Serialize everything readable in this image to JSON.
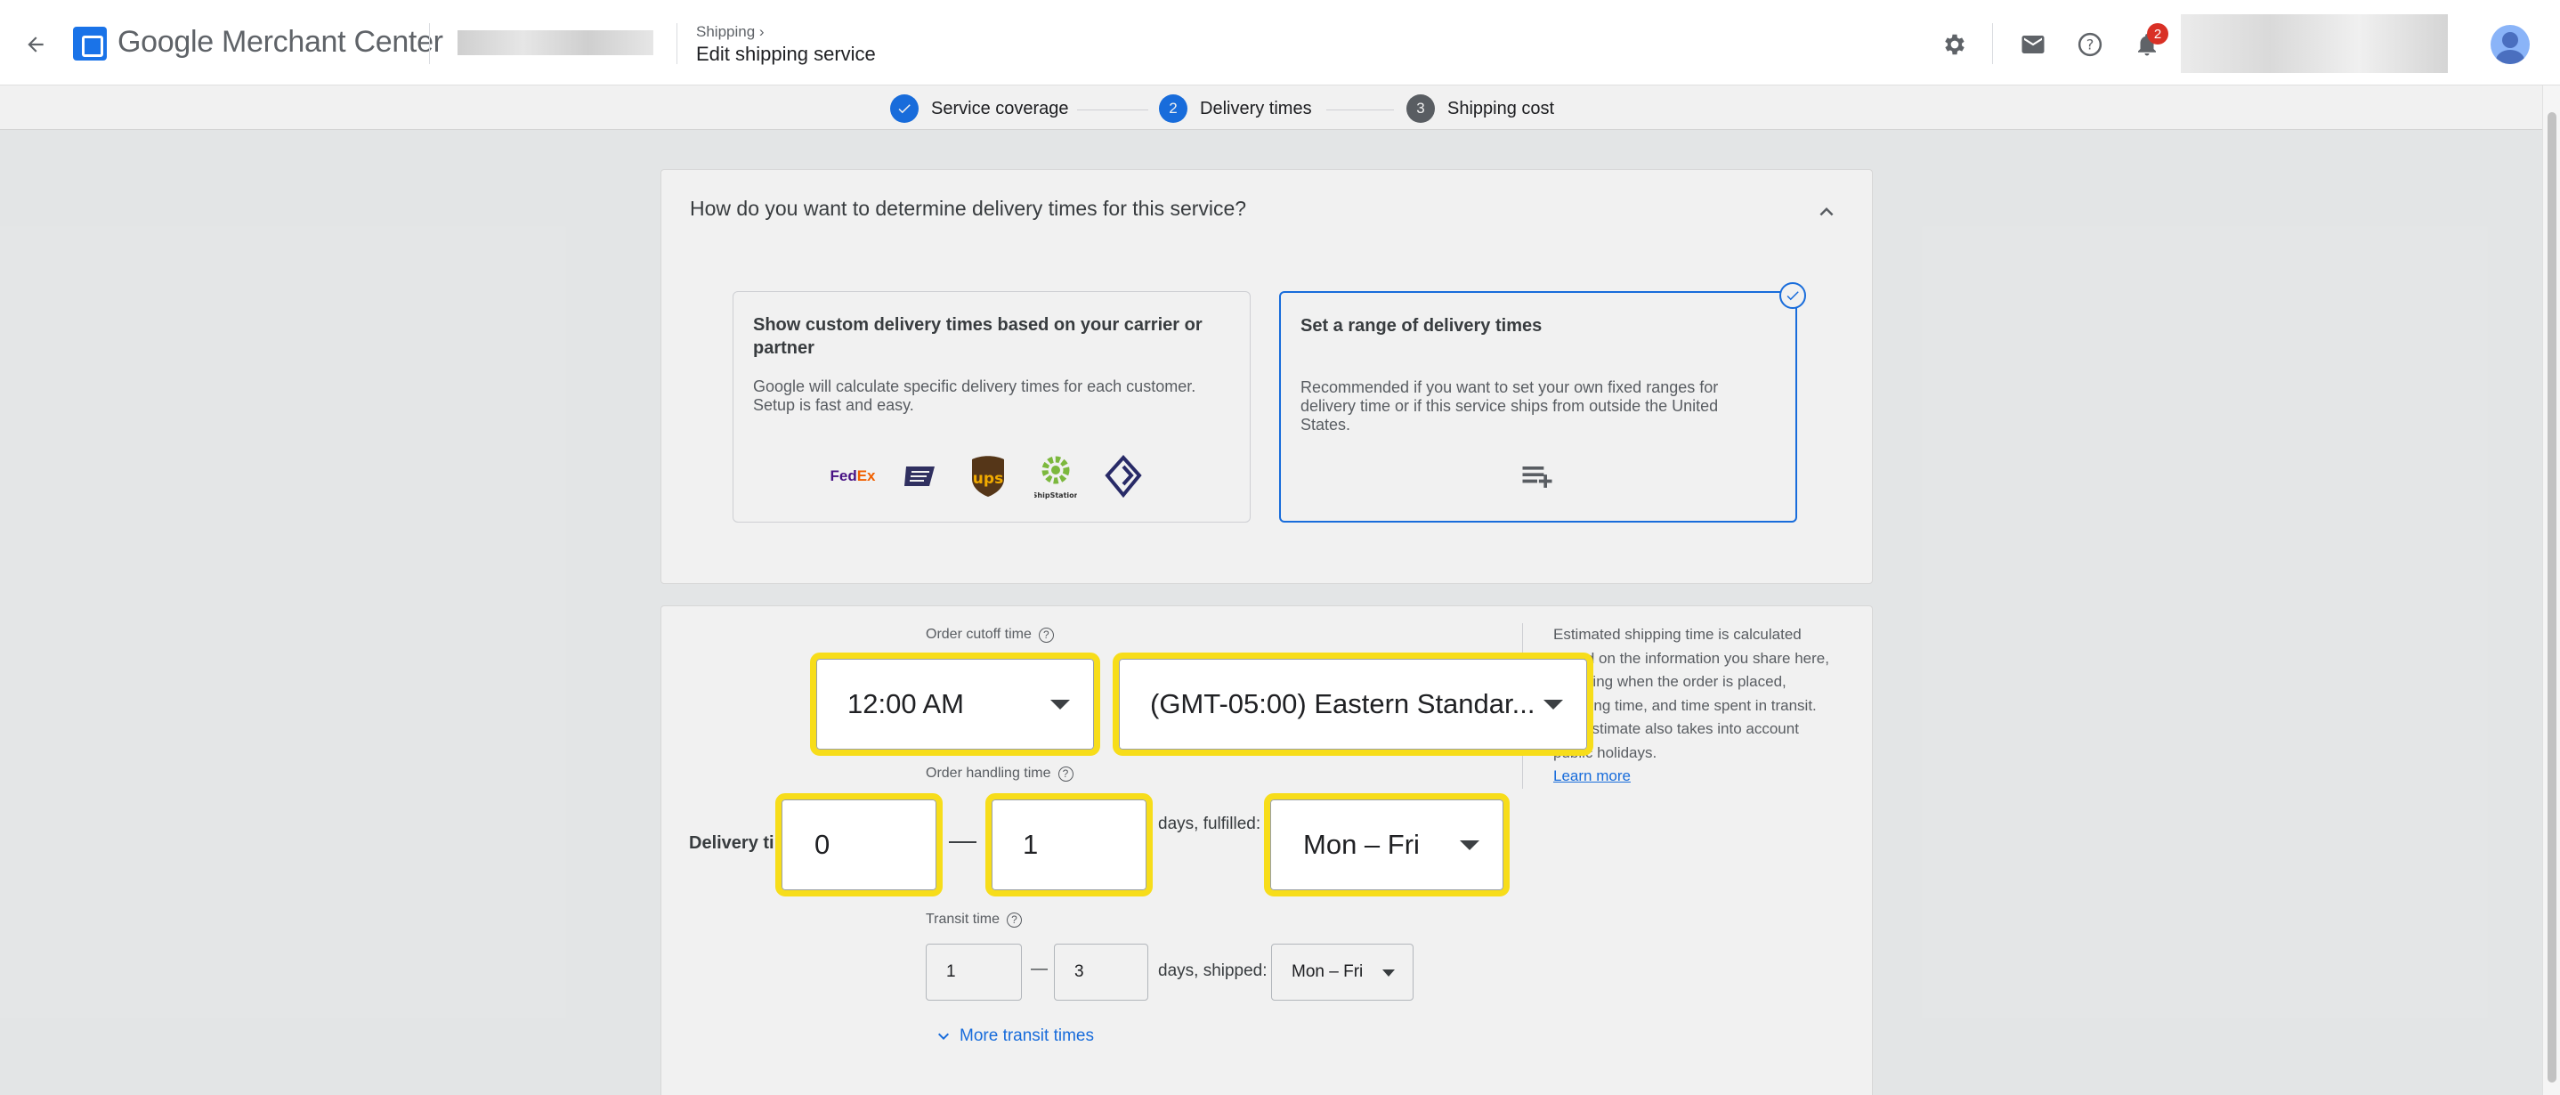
{
  "app": {
    "name": "Google Merchant Center"
  },
  "breadcrumb": {
    "parent": "Shipping",
    "title": "Edit shipping service"
  },
  "topbar": {
    "notification_count": "2"
  },
  "stepper": {
    "steps": [
      {
        "number": "",
        "label": "Service coverage",
        "state": "done"
      },
      {
        "number": "2",
        "label": "Delivery times",
        "state": "active"
      },
      {
        "number": "3",
        "label": "Shipping cost",
        "state": "pending"
      }
    ]
  },
  "question": {
    "title": "How do you want to determine delivery times for this service?",
    "options": [
      {
        "title": "Show custom delivery times based on your carrier or partner",
        "description": "Google will calculate specific delivery times for each customer. Setup is fast and easy.",
        "carriers": [
          "FedEx",
          "USPS",
          "UPS",
          "ShipStation",
          "Other carrier"
        ]
      },
      {
        "title": "Set a range of delivery times",
        "description": "Recommended if you want to set your own fixed ranges for delivery time or if this service ships from outside the United States.",
        "selected": true
      }
    ]
  },
  "delivery": {
    "row_label": "Delivery tir",
    "cutoff": {
      "label": "Order cutoff time",
      "time": "12:00 AM",
      "timezone": "(GMT-05:00) Eastern Standar..."
    },
    "handling": {
      "label": "Order handling time",
      "min": "0",
      "max": "1",
      "suffix": "days, fulfilled:",
      "days": "Mon – Fri"
    },
    "transit": {
      "label": "Transit time",
      "min": "1",
      "max": "3",
      "suffix": "days, shipped:",
      "days": "Mon – Fri"
    },
    "more_link": "More transit times",
    "dash": "—"
  },
  "info": {
    "text": "Estimated shipping time is calculated based on the information you share here, including when the order is placed, handling time, and time spent in transit. The estimate also takes into account public holidays.",
    "link": "Learn more"
  },
  "colors": {
    "accent": "#1a73e8",
    "highlight": "#f7dd1a",
    "badge": "#d93025"
  }
}
